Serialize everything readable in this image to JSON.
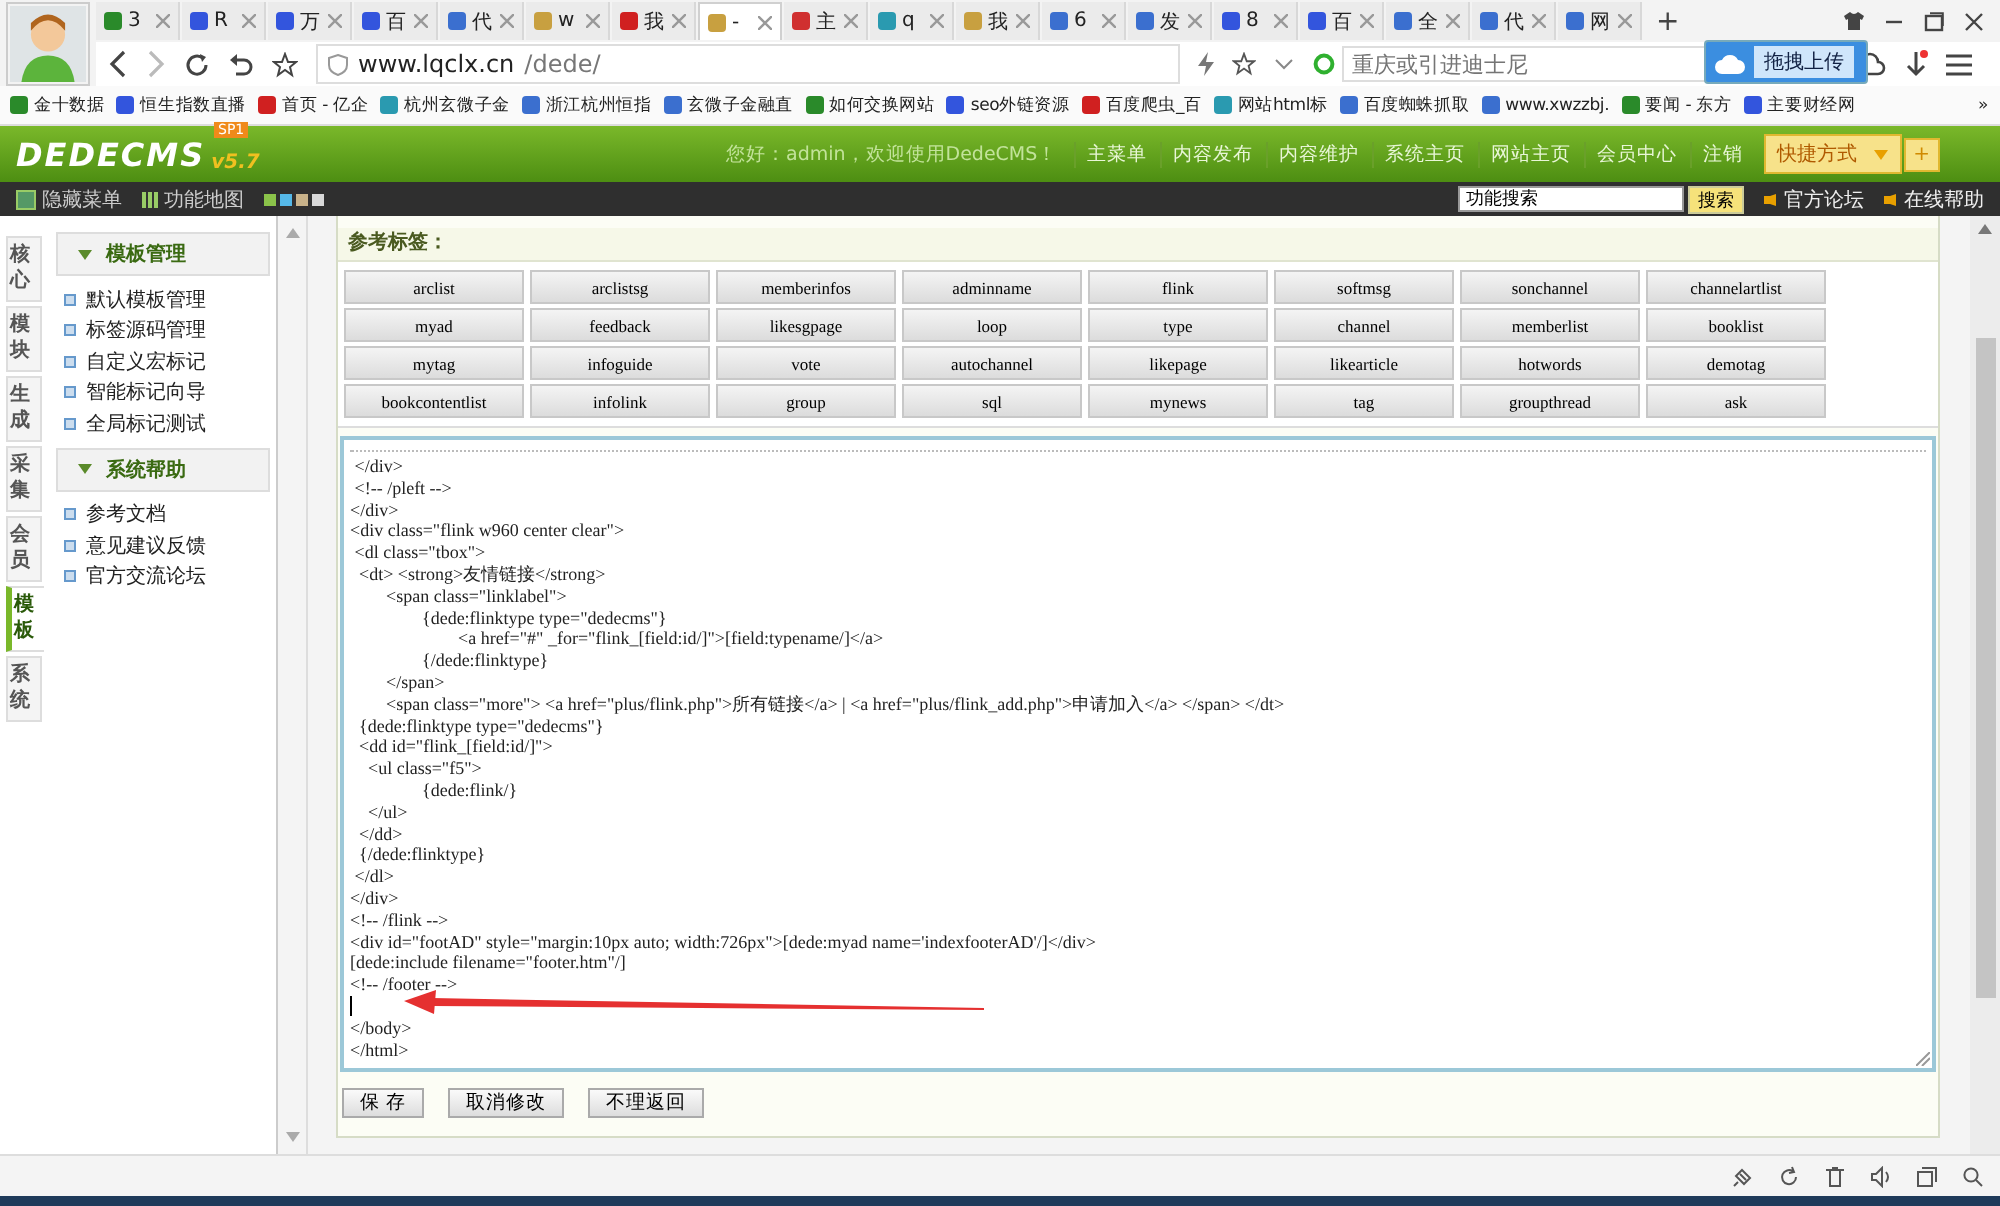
{
  "browser": {
    "tabs": [
      {
        "label": "3",
        "selected": false
      },
      {
        "label": "R",
        "selected": false
      },
      {
        "label": "万",
        "selected": false
      },
      {
        "label": "百",
        "selected": false
      },
      {
        "label": "代",
        "selected": false
      },
      {
        "label": "w",
        "selected": false
      },
      {
        "label": "我",
        "selected": false
      },
      {
        "label": "-",
        "selected": true
      },
      {
        "label": "主",
        "selected": false
      },
      {
        "label": "q",
        "selected": false
      },
      {
        "label": "我",
        "selected": false
      },
      {
        "label": "6",
        "selected": false
      },
      {
        "label": "发",
        "selected": false
      },
      {
        "label": "8",
        "selected": false
      },
      {
        "label": "百",
        "selected": false
      },
      {
        "label": "全",
        "selected": false
      },
      {
        "label": "代",
        "selected": false
      },
      {
        "label": "网",
        "selected": false
      }
    ],
    "new_tab": "+",
    "url": {
      "host": "www.lqclx.cn",
      "path": "/dede/"
    },
    "search": {
      "placeholder": "重庆或引进迪士尼"
    },
    "upload_popup": "拖拽上传",
    "bookmarks": [
      "金十数据",
      "恒生指数直播",
      "首页 - 亿企",
      "杭州玄微子金",
      "浙江杭州恒指",
      "玄微子金融直",
      "如何交换网站",
      "seo外链资源",
      "百度爬虫_百",
      "网站html标",
      "百度蜘蛛抓取",
      "www.xwzzbj.",
      "要闻 - 东方",
      "主要财经网"
    ],
    "more_bookmarks": "»"
  },
  "header": {
    "logo": "DEDECMS",
    "version": "v5.7",
    "badge": "SP1",
    "greeting": "您好：admin，欢迎使用DedeCMS！",
    "nav": [
      "主菜单",
      "内容发布",
      "内容维护",
      "系统主页",
      "网站主页",
      "会员中心",
      "注销"
    ],
    "shortcut": "快捷方式",
    "plus": "+"
  },
  "toolbar": {
    "items": [
      "隐藏菜单",
      "功能地图"
    ],
    "search_value": "功能搜索",
    "search_button": "搜索",
    "links": [
      "官方论坛",
      "在线帮助"
    ]
  },
  "side_tabs": [
    {
      "label": "核心",
      "selected": false
    },
    {
      "label": "模块",
      "selected": false
    },
    {
      "label": "生成",
      "selected": false
    },
    {
      "label": "采集",
      "selected": false
    },
    {
      "label": "会员",
      "selected": false
    },
    {
      "label": "模板",
      "selected": true
    },
    {
      "label": "系统",
      "selected": false
    }
  ],
  "sidebar": [
    {
      "title": "模板管理",
      "expanded": true,
      "items": [
        "默认模板管理",
        "标签源码管理",
        "自定义宏标记",
        "智能标记向导",
        "全局标记测试"
      ]
    },
    {
      "title": "系统帮助",
      "expanded": true,
      "items": [
        "参考文档",
        "意见建议反馈",
        "官方交流论坛"
      ]
    }
  ],
  "reference": {
    "title": "参考标签：",
    "tags": [
      "arclist",
      "arclistsg",
      "memberinfos",
      "adminname",
      "flink",
      "softmsg",
      "sonchannel",
      "channelartlist",
      "myad",
      "feedback",
      "likesgpage",
      "loop",
      "type",
      "channel",
      "memberlist",
      "booklist",
      "mytag",
      "infoguide",
      "vote",
      "autochannel",
      "likepage",
      "likearticle",
      "hotwords",
      "demotag",
      "bookcontentlist",
      "infolink",
      "group",
      "sql",
      "mynews",
      "tag",
      "groupthread",
      "ask"
    ]
  },
  "editor": {
    "lines": [
      {
        "kind": "text",
        "text": " </div>"
      },
      {
        "kind": "text",
        "text": " <!-- /pleft -->"
      },
      {
        "kind": "text",
        "text": "</div>"
      },
      {
        "kind": "text",
        "text": "<div class=\"flink w960 center clear\">"
      },
      {
        "kind": "text",
        "text": " <dl class=\"tbox\">"
      },
      {
        "kind": "text",
        "text": "  <dt> <strong>友情链接</strong>"
      },
      {
        "kind": "text",
        "text": "\t<span class=\"linklabel\">"
      },
      {
        "kind": "text",
        "text": "\t\t{dede:flinktype type=\"dedecms\"}"
      },
      {
        "kind": "text",
        "text": "\t\t\t<a href=\"#\" _for=\"flink_[field:id/]\">[field:typename/]</a>"
      },
      {
        "kind": "text",
        "text": "\t\t{/dede:flinktype}"
      },
      {
        "kind": "text",
        "text": "\t</span>"
      },
      {
        "kind": "text",
        "text": "\t<span class=\"more\"> <a href=\"plus/flink.php\">所有链接</a> | <a href=\"plus/flink_add.php\">申请加入</a> </span> </dt>"
      },
      {
        "kind": "text",
        "text": "  {dede:flinktype type=\"dedecms\"}"
      },
      {
        "kind": "text",
        "text": "  <dd id=\"flink_[field:id/]\">"
      },
      {
        "kind": "text",
        "text": "    <ul class=\"f5\">"
      },
      {
        "kind": "text",
        "text": "\t\t{dede:flink/}"
      },
      {
        "kind": "text",
        "text": "    </ul>"
      },
      {
        "kind": "text",
        "text": "  </dd>"
      },
      {
        "kind": "text",
        "text": "  {/dede:flinktype}"
      },
      {
        "kind": "text",
        "text": " </dl>"
      },
      {
        "kind": "text",
        "text": "</div>"
      },
      {
        "kind": "text",
        "text": "<!-- /flink -->"
      },
      {
        "kind": "text",
        "text": "<div id=\"footAD\" style=\"margin:10px auto; width:726px\">[dede:myad name='indexfooterAD'/]</div>"
      },
      {
        "kind": "text",
        "text": "[dede:include filename=\"footer.htm\"/]"
      },
      {
        "kind": "text",
        "text": "<!-- /footer -->"
      },
      {
        "kind": "cursor"
      },
      {
        "kind": "text",
        "text": "</body>"
      },
      {
        "kind": "text",
        "text": "</html>"
      }
    ]
  },
  "buttons": [
    "保 存",
    "取消修改",
    "不理返回"
  ]
}
